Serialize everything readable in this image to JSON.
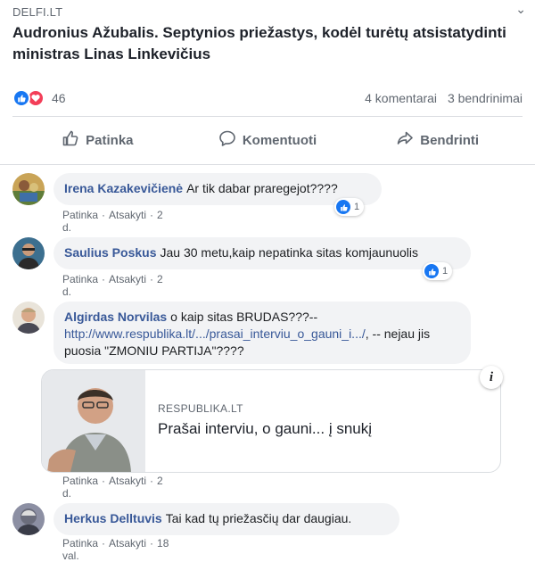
{
  "post": {
    "source": "DELFI.LT",
    "title": "Audronius Ažubalis. Septynios priežastys, kodėl turėtų atsistatydinti ministras Linas Linkevičius"
  },
  "stats": {
    "reactions_count": "46",
    "comments": "4 komentarai",
    "shares": "3 bendrinimai"
  },
  "actions": {
    "like": "Patinka",
    "comment": "Komentuoti",
    "share": "Bendrinti"
  },
  "comments": [
    {
      "author": "Irena Kazakevičienė",
      "text": "Ar tik dabar praregejot????",
      "like": "Patinka",
      "reply": "Atsakyti",
      "time": "2 d.",
      "reactions": "1"
    },
    {
      "author": "Saulius Poskus",
      "text": "Jau 30 metu,kaip nepatinka sitas komjaunuolis",
      "like": "Patinka",
      "reply": "Atsakyti",
      "time": "2 d.",
      "reactions": "1"
    },
    {
      "author": "Algirdas Norvilas",
      "text_before": "o kaip sitas BRUDAS???--",
      "link": "http://www.respublika.lt/.../prasai_interviu_o_gauni_i.../",
      "text_after": ", -- nejau jis puosia \"ZMONIU PARTIJA\"????",
      "like": "Patinka",
      "reply": "Atsakyti",
      "time": "2 d.",
      "preview": {
        "domain": "RESPUBLIKA.LT",
        "title": "Prašai interviu, o gauni... į snukį",
        "info": "i"
      }
    },
    {
      "author": "Herkus Delltuvis",
      "text": "Tai kad tų priežasčių dar daugiau.",
      "like": "Patinka",
      "reply": "Atsakyti",
      "time": "18 val."
    }
  ],
  "meta_separator": "·",
  "icons": [
    "like-icon",
    "love-icon",
    "thumbs-up-icon",
    "comment-icon",
    "share-icon",
    "info-icon",
    "caret-icon"
  ],
  "colors": {
    "brand_blue": "#1877f2",
    "author_blue": "#385898",
    "love_red": "#f33e58",
    "meta_gray": "#606770",
    "bubble_bg": "#f2f3f5"
  }
}
